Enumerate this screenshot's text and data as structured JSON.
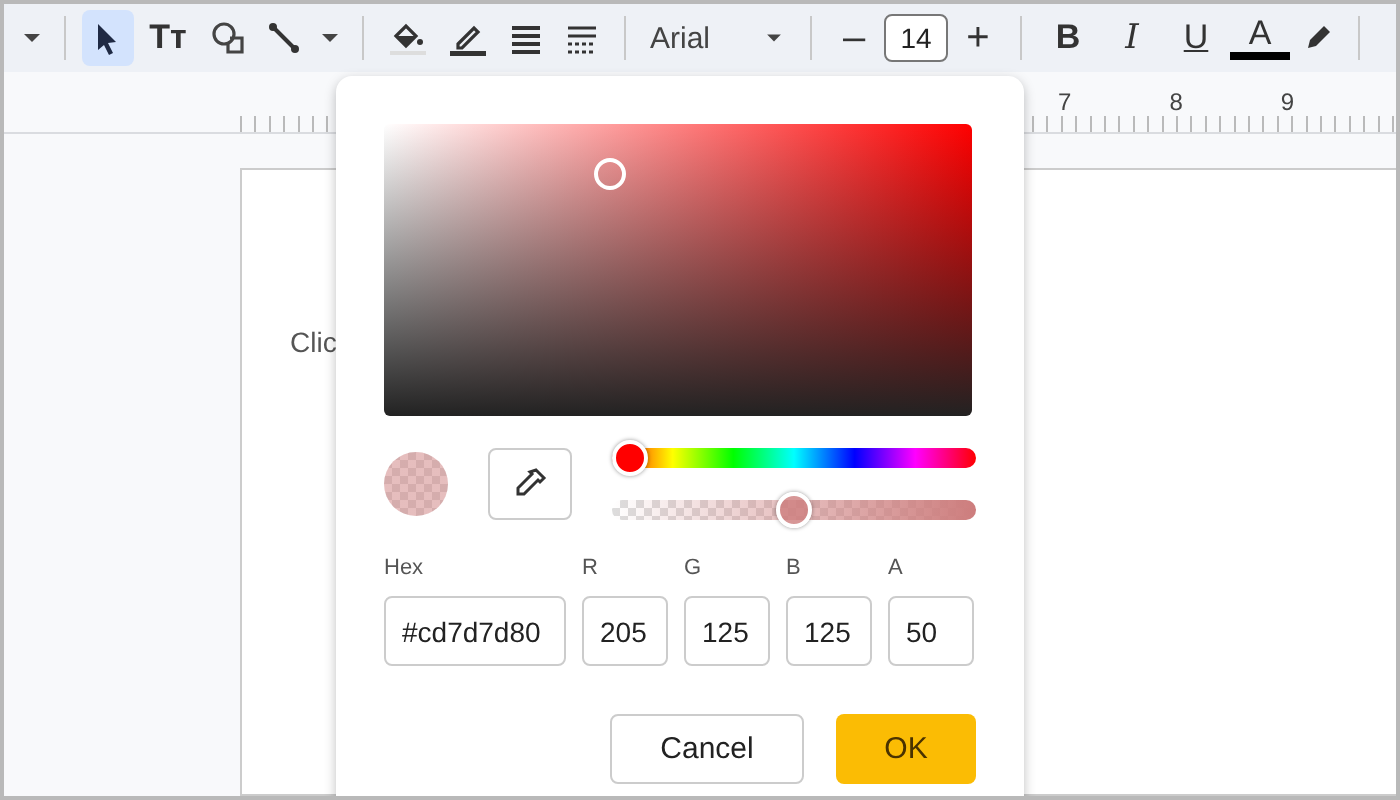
{
  "toolbar": {
    "tools": [
      {
        "selected": false
      },
      {
        "selected": true
      },
      {
        "selected": false
      },
      {
        "selected": false
      },
      {
        "selected": false
      },
      {
        "selected": false
      },
      {
        "selected": false
      },
      {
        "selected": false
      },
      {
        "selected": false
      },
      {
        "selected": false
      }
    ],
    "text_tool_label": "Tт",
    "font": "Arial",
    "font_size": "14",
    "decrease": "–",
    "increase": "+",
    "format_buttons": [
      {
        "label": "B",
        "kind": "bold"
      },
      {
        "label": "I",
        "kind": "italic"
      },
      {
        "label": "U",
        "kind": "underline"
      },
      {
        "label": "A",
        "kind": "color"
      }
    ]
  },
  "ruler": {
    "labels": [
      "7",
      "8",
      "9"
    ]
  },
  "document": {
    "text": "Clic"
  },
  "color_picker": {
    "hue": {
      "level": 0
    },
    "alpha": {
      "level": 0.5
    },
    "fields": [
      {
        "label": "Hex",
        "value": "#cd7d7d80"
      },
      {
        "label": "R",
        "value": "205"
      },
      {
        "label": "G",
        "value": "125"
      },
      {
        "label": "B",
        "value": "125"
      },
      {
        "label": "A",
        "value": "50"
      }
    ],
    "buttons": [
      {
        "label": "Cancel",
        "kind": "secondary"
      },
      {
        "label": "OK",
        "kind": "primary"
      }
    ]
  }
}
